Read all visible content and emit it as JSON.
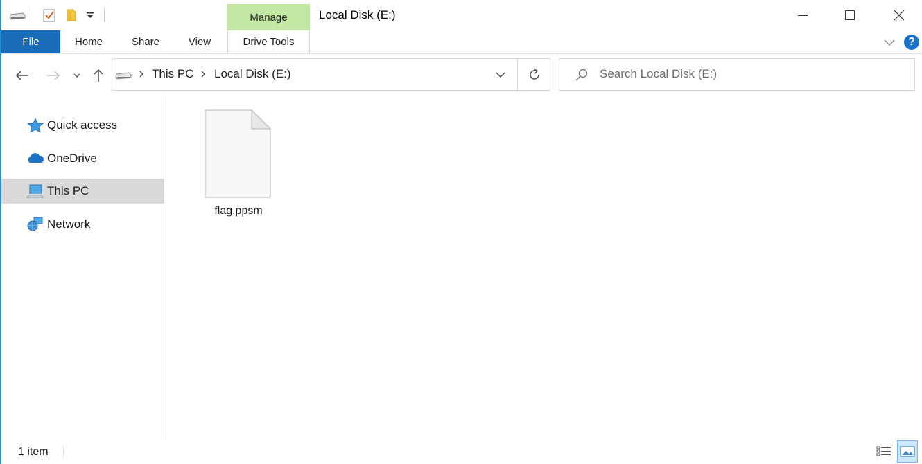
{
  "window": {
    "title": "Local Disk (E:)",
    "context_tab_group": "Manage",
    "controls": {
      "minimize": "minimize-icon",
      "maximize": "maximize-icon",
      "close": "close-icon"
    }
  },
  "ribbon": {
    "tabs": [
      {
        "label": "File"
      },
      {
        "label": "Home"
      },
      {
        "label": "Share"
      },
      {
        "label": "View"
      },
      {
        "label": "Drive Tools"
      }
    ],
    "help_label": "?"
  },
  "address": {
    "breadcrumbs": [
      "This PC",
      "Local Disk (E:)"
    ],
    "search_placeholder": "Search Local Disk (E:)"
  },
  "nav_pane": {
    "items": [
      {
        "label": "Quick access",
        "icon": "star-icon",
        "selected": false
      },
      {
        "label": "OneDrive",
        "icon": "cloud-icon",
        "selected": false
      },
      {
        "label": "This PC",
        "icon": "computer-icon",
        "selected": true
      },
      {
        "label": "Network",
        "icon": "network-icon",
        "selected": false
      }
    ]
  },
  "content": {
    "files": [
      {
        "name": "flag.ppsm",
        "icon": "blank-file-icon"
      }
    ]
  },
  "status": {
    "item_count": "1 item"
  },
  "colors": {
    "file_tab": "#1a6bb5",
    "manage_tab": "#c2e8a3",
    "selection": "#d9d9d9",
    "help": "#1a73c8"
  }
}
